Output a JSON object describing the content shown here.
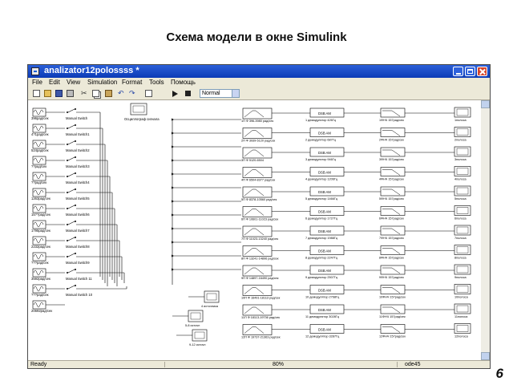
{
  "slide": {
    "title": "Схема модели   в окне Simulink",
    "page_number": "6"
  },
  "window": {
    "title": "analizator12polossss *"
  },
  "menu": [
    "File",
    "Edit",
    "View",
    "Simulation",
    "Format",
    "Tools",
    "Помощь"
  ],
  "toolbar": {
    "sim_mode": "Normal",
    "icons": [
      "new-icon",
      "open-icon",
      "save-icon",
      "print-icon",
      "cut-icon",
      "copy-icon",
      "paste-icon",
      "undo-icon",
      "redo-icon",
      "library-icon",
      "play-icon",
      "stop-icon"
    ]
  },
  "status": {
    "ready": "Ready",
    "zoom": "80%",
    "solver": "ode45"
  },
  "model": {
    "sources": [
      "396рад/сек",
      "4?1рад/сек",
      "524рад/сек",
      "??рад/сек",
      "??рад/сек",
      "1263рад/сек",
      "15??рад/сек",
      "1795рад/сек",
      "2232рад/сек",
      "???рад/сек",
      "3592рад/сек",
      "???рад/сек",
      "20692рад/сек"
    ],
    "switches": [
      "Manual Switch",
      "Manual Switch1",
      "Manual Switch2",
      "Manual Switch3",
      "Manual Switch4",
      "Manual Switch5",
      "Manual Switch6",
      "Manual Switch7",
      "Manual Switch8",
      "Manual Switch9",
      "Manual Switch 11",
      "Manual Switch 10"
    ],
    "scope_top": "Осциллограф сигнала",
    "filters": [
      "1П Ф 396-3980 рад/сек",
      "2П Ф 3939-5120 рад/сек",
      "3П Ф 5120-6504",
      "4П Ф 6504-8377 рад/сек",
      "5П Ф 8378-10560 рад/сек",
      "6П Ф 10601-11023 рад/сек",
      "7П Ф 11023-13240 рад/сек",
      "8П Ф 13241-14896 рад/сек",
      "9П Ф 14897-16490 рад/сек",
      "10П Ф 16491-18113 рад/сек",
      "11П Ф 18113-19736 рад/сек",
      "12П Ф 19737-21363 рад/сек"
    ],
    "dsb_label": "DSB AM",
    "demods": [
      "1 демодулятор 426Гц",
      "2 демодулятор 687Гц",
      "3 демодулятор 946Гц",
      "4 демодулятор 1206Гц",
      "5 демодулятор 1466Гц",
      "6 демодулятор 1727Гц",
      "7 демодулятор 1988Гц",
      "8 демодулятор 2247Гц",
      "9 демодулятор 2507Гц",
      "10 демодулятор 2768Гц",
      "11 демодулятор 3028Гц",
      "12 демодулятор 3287Гц"
    ],
    "lpfs": [
      "1ФНЧ 157рад/сек",
      "2ФНЧ 157рад/сек",
      "3ФНЧ 157рад/сек",
      "4ФНЧ 157рад/сек",
      "5ФНЧ 157рад/сек",
      "6ФНЧ 157рад/сек",
      "7ФНЧ 157рад/сек",
      "8ФНЧ 157рад/сек",
      "9ФНЧ 157рад/сек",
      "10ФНЧ 157рад/сек",
      "11ФНЧ 157рад/сек",
      "12ФНЧ 157рад/сек"
    ],
    "outputs": [
      "1полоса",
      "2полоса",
      "3полоса",
      "4полоса",
      "5полоса",
      "6полоса",
      "7полоса",
      "8полоса",
      "9полоса",
      "10полоса",
      "11полоса",
      "12полоса"
    ],
    "bottom_scopes": [
      "4 источника",
      "5-8 источн",
      "9-12 источн"
    ]
  }
}
